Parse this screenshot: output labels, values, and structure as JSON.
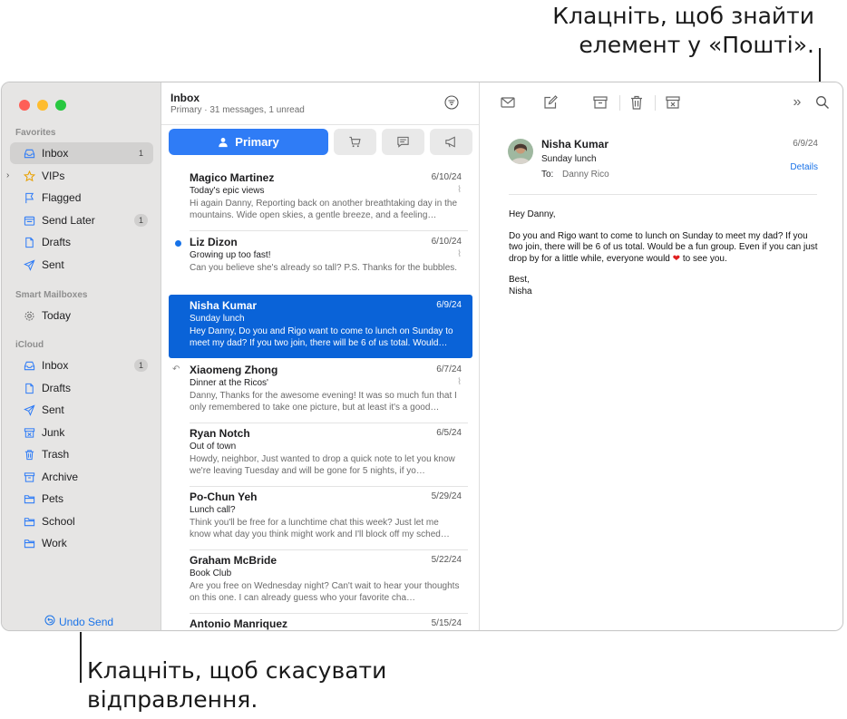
{
  "callouts": {
    "search_line1": "Клацніть, щоб знайти",
    "search_line2": "елемент у «Пошті».",
    "undo_line1": "Клацніть, щоб скасувати",
    "undo_line2": "відправлення."
  },
  "sidebar": {
    "favorites_header": "Favorites",
    "favorites": [
      {
        "label": "Inbox",
        "count": "1",
        "icon": "tray-icon"
      },
      {
        "label": "VIPs",
        "icon": "star-icon"
      },
      {
        "label": "Flagged",
        "icon": "flag-icon"
      },
      {
        "label": "Send Later",
        "count": "1",
        "icon": "send-later-icon"
      },
      {
        "label": "Drafts",
        "icon": "document-icon"
      },
      {
        "label": "Sent",
        "icon": "paperplane-icon"
      }
    ],
    "smart_header": "Smart Mailboxes",
    "smart": [
      {
        "label": "Today",
        "icon": "gear-icon"
      }
    ],
    "icloud_header": "iCloud",
    "icloud": [
      {
        "label": "Inbox",
        "count": "1",
        "icon": "tray-icon"
      },
      {
        "label": "Drafts",
        "icon": "document-icon"
      },
      {
        "label": "Sent",
        "icon": "paperplane-icon"
      },
      {
        "label": "Junk",
        "icon": "junk-icon"
      },
      {
        "label": "Trash",
        "icon": "trash-icon"
      },
      {
        "label": "Archive",
        "icon": "archive-icon"
      },
      {
        "label": "Pets",
        "icon": "folder-icon"
      },
      {
        "label": "School",
        "icon": "folder-icon"
      },
      {
        "label": "Work",
        "icon": "folder-icon"
      }
    ],
    "undo_send": "Undo Send"
  },
  "list": {
    "title": "Inbox",
    "subtitle": "Primary · 31 messages, 1 unread",
    "primary_tab": "Primary",
    "messages": [
      {
        "from": "Magico Martinez",
        "date": "6/10/24",
        "subject": "Today's epic views",
        "preview": "Hi again Danny, Reporting back on another breathtaking day in the mountains. Wide open skies, a gentle breeze, and a feeling…"
      },
      {
        "from": "Liz Dizon",
        "date": "6/10/24",
        "subject": "Growing up too fast!",
        "preview": "Can you believe she's already so tall? P.S. Thanks for the bubbles."
      },
      {
        "from": "Nisha Kumar",
        "date": "6/9/24",
        "subject": "Sunday lunch",
        "preview": "Hey Danny, Do you and Rigo want to come to lunch on Sunday to meet my dad? If you two join, there will be 6 of us total. Would…"
      },
      {
        "from": "Xiaomeng Zhong",
        "date": "6/7/24",
        "subject": "Dinner at the Ricos'",
        "preview": "Danny, Thanks for the awesome evening! It was so much fun that I only remembered to take one picture, but at least it's a good…"
      },
      {
        "from": "Ryan Notch",
        "date": "6/5/24",
        "subject": "Out of town",
        "preview": "Howdy, neighbor, Just wanted to drop a quick note to let you know we're leaving Tuesday and will be gone for 5 nights, if yo…"
      },
      {
        "from": "Po-Chun Yeh",
        "date": "5/29/24",
        "subject": "Lunch call?",
        "preview": "Think you'll be free for a lunchtime chat this week? Just let me know what day you think might work and I'll block off my sched…"
      },
      {
        "from": "Graham McBride",
        "date": "5/22/24",
        "subject": "Book Club",
        "preview": "Are you free on Wednesday night? Can't wait to hear your thoughts on this one. I can already guess who your favorite cha…"
      },
      {
        "from": "Antonio Manriquez",
        "date": "5/15/24",
        "subject": "",
        "preview": ""
      }
    ]
  },
  "reader": {
    "from": "Nisha Kumar",
    "subject": "Sunday lunch",
    "to_label": "To:",
    "to": "Danny Rico",
    "date": "6/9/24",
    "details": "Details",
    "greeting": "Hey Danny,",
    "body_1": "Do you and Rigo want to come to lunch on Sunday to meet my dad? If you two join, there will be 6 of us total. Would be a fun group. Even if you can just drop by for a little while, everyone would",
    "body_2": "to see you.",
    "signoff": "Best,",
    "signature": "Nisha"
  },
  "colors": {
    "accent": "#2f7cf6",
    "selected_row": "#0a63d8",
    "sidebar_bg": "#e6e5e4"
  }
}
